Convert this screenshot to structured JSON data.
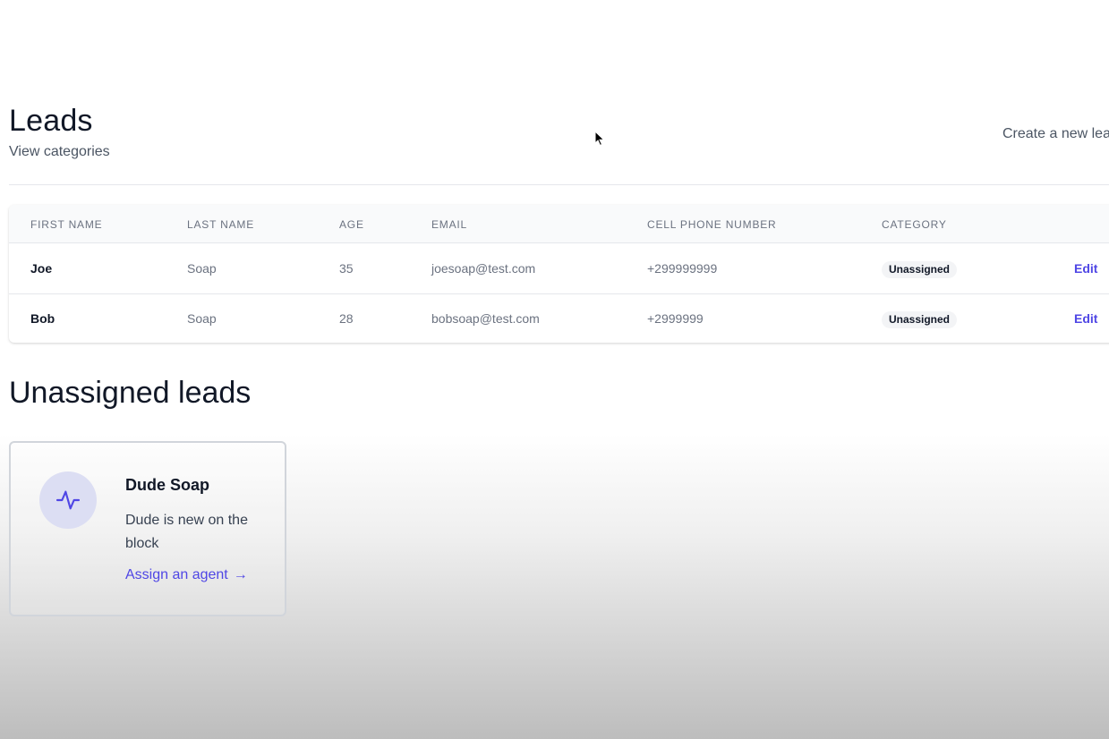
{
  "header": {
    "title": "Leads",
    "view_categories": "View categories",
    "create_lead": "Create a new lea"
  },
  "table": {
    "columns": [
      "FIRST NAME",
      "LAST NAME",
      "AGE",
      "EMAIL",
      "CELL PHONE NUMBER",
      "CATEGORY"
    ],
    "rows": [
      {
        "first_name": "Joe",
        "last_name": "Soap",
        "age": "35",
        "email": "joesoap@test.com",
        "phone": "+299999999",
        "category": "Unassigned",
        "action": "Edit"
      },
      {
        "first_name": "Bob",
        "last_name": "Soap",
        "age": "28",
        "email": "bobsoap@test.com",
        "phone": "+2999999",
        "category": "Unassigned",
        "action": "Edit"
      }
    ]
  },
  "unassigned": {
    "title": "Unassigned leads",
    "cards": [
      {
        "name": "Dude Soap",
        "description": "Dude is new on the block",
        "action": "Assign an agent",
        "arrow": "→",
        "icon": "activity-icon"
      }
    ]
  },
  "colors": {
    "accent": "#4f46e5",
    "badge_bg": "#f3f4f6",
    "icon_bg": "#dcdef3"
  }
}
